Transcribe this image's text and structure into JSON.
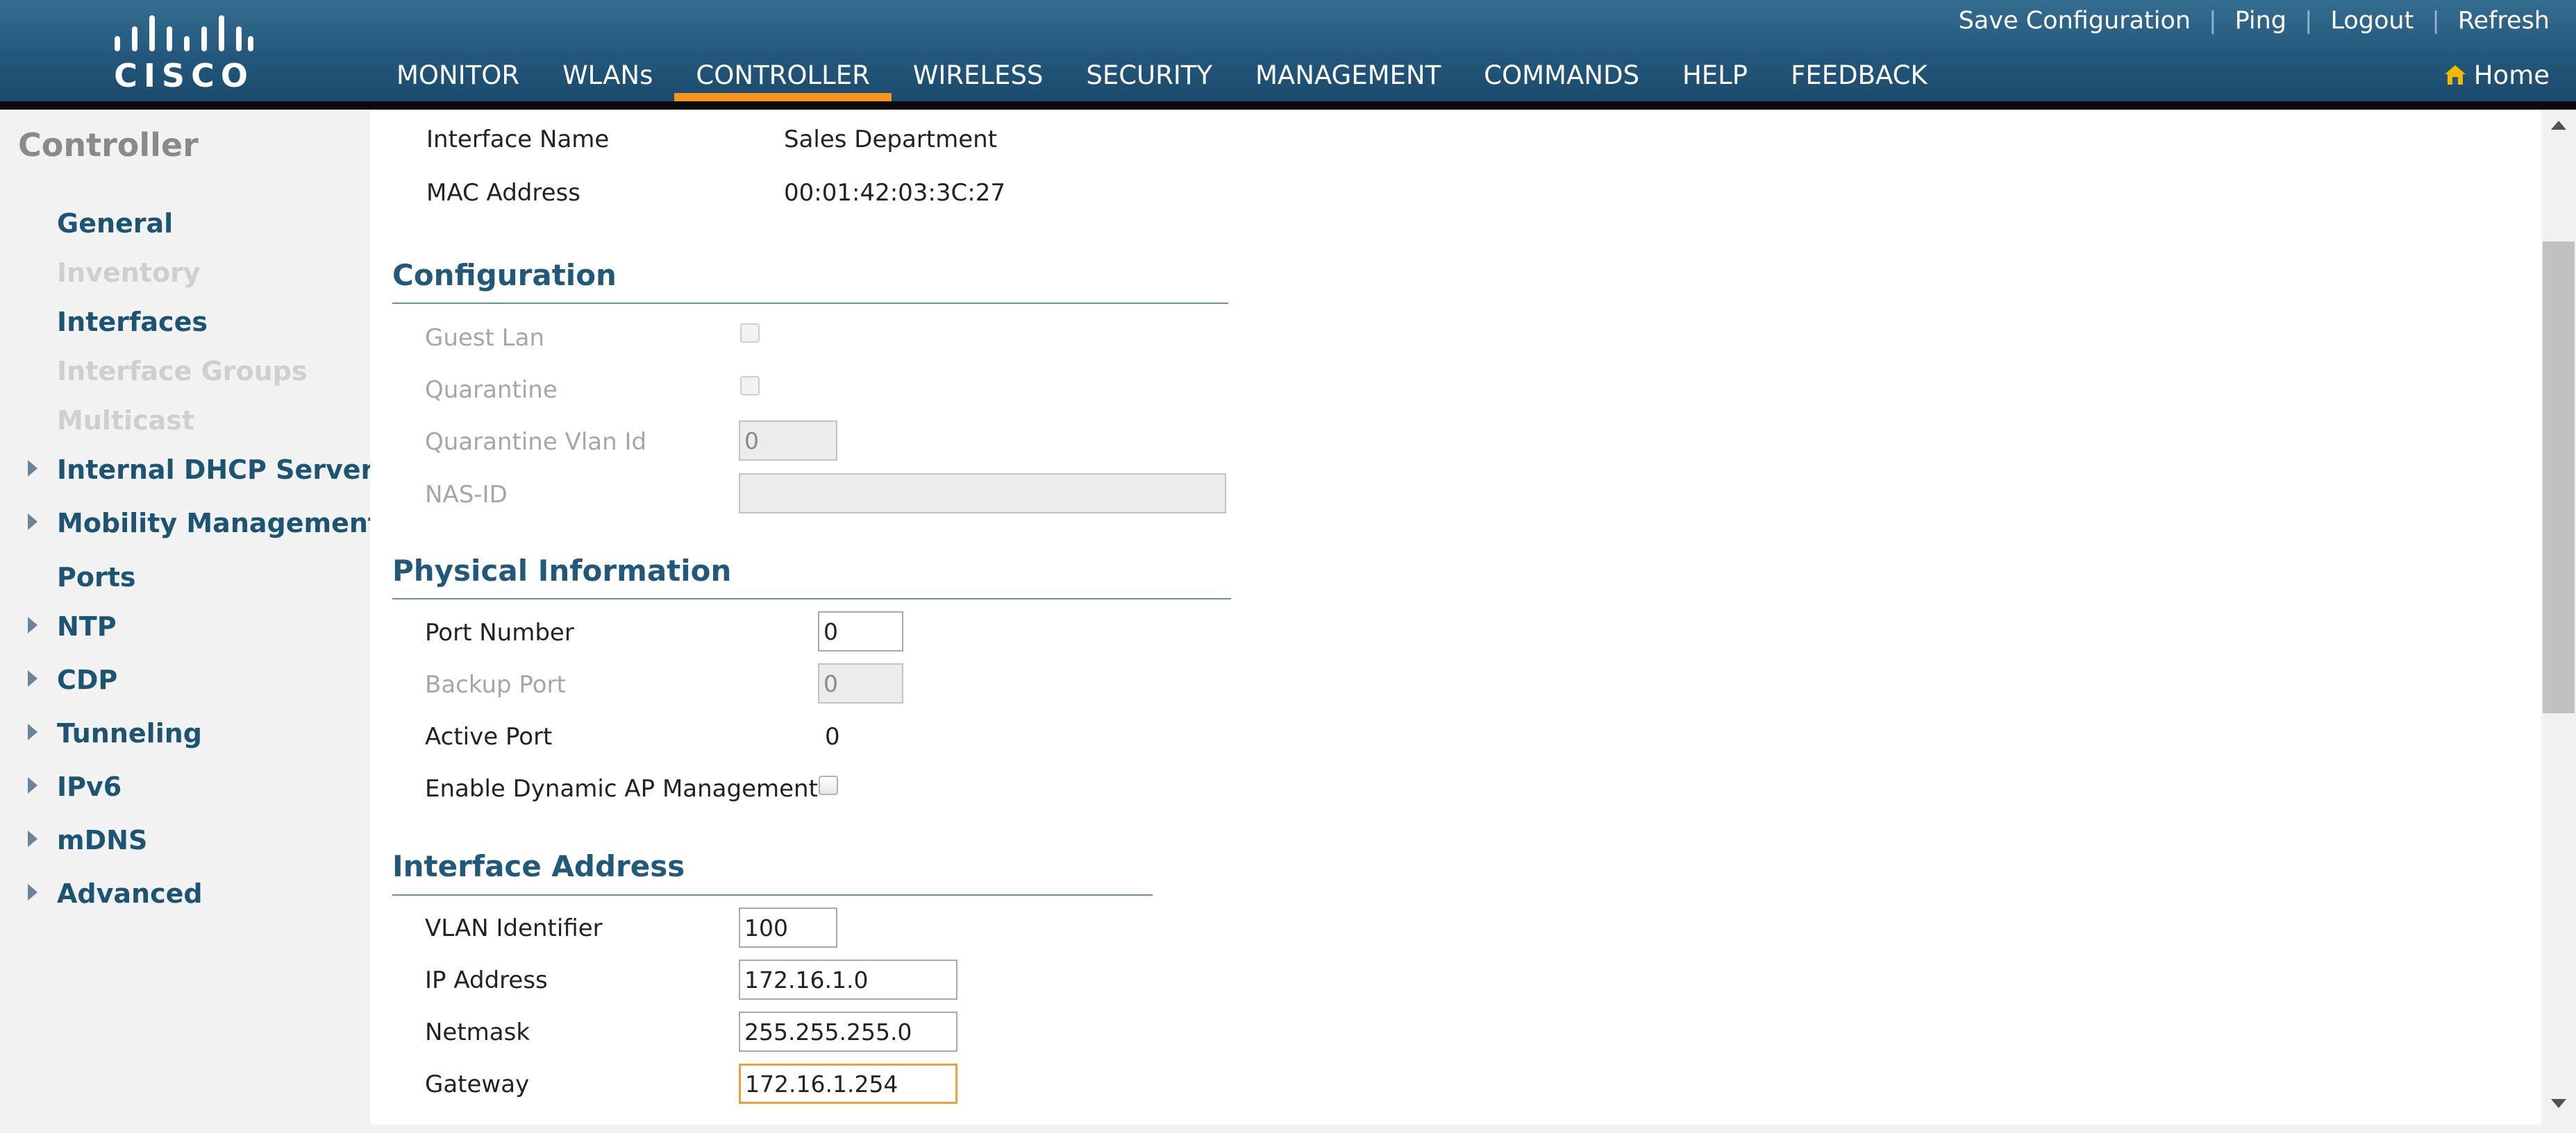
{
  "header": {
    "logo_text": "CISCO",
    "top_links": {
      "save_configuration": "Save Configuration",
      "ping": "Ping",
      "logout": "Logout",
      "refresh": "Refresh",
      "separator": "|"
    },
    "nav": [
      "MONITOR",
      "WLANs",
      "CONTROLLER",
      "WIRELESS",
      "SECURITY",
      "MANAGEMENT",
      "COMMANDS",
      "HELP",
      "FEEDBACK"
    ],
    "active_nav": "CONTROLLER",
    "home_label": "Home"
  },
  "sidebar": {
    "title": "Controller",
    "items": [
      {
        "label": "General",
        "enabled": true,
        "expandable": false
      },
      {
        "label": "Inventory",
        "enabled": false,
        "expandable": false
      },
      {
        "label": "Interfaces",
        "enabled": true,
        "expandable": false
      },
      {
        "label": "Interface Groups",
        "enabled": false,
        "expandable": false
      },
      {
        "label": "Multicast",
        "enabled": false,
        "expandable": false
      },
      {
        "label": "Internal DHCP Server",
        "enabled": true,
        "expandable": true
      },
      {
        "label": "Mobility Management",
        "enabled": true,
        "expandable": true
      },
      {
        "label": "Ports",
        "enabled": true,
        "expandable": false
      },
      {
        "label": "NTP",
        "enabled": true,
        "expandable": true
      },
      {
        "label": "CDP",
        "enabled": true,
        "expandable": true
      },
      {
        "label": "Tunneling",
        "enabled": true,
        "expandable": true
      },
      {
        "label": "IPv6",
        "enabled": true,
        "expandable": true
      },
      {
        "label": "mDNS",
        "enabled": true,
        "expandable": true
      },
      {
        "label": "Advanced",
        "enabled": true,
        "expandable": true
      }
    ]
  },
  "general": {
    "interface_name_label": "Interface Name",
    "interface_name_value": "Sales Department",
    "mac_address_label": "MAC Address",
    "mac_address_value": "00:01:42:03:3C:27"
  },
  "configuration": {
    "title": "Configuration",
    "guest_lan_label": "Guest Lan",
    "guest_lan_checked": false,
    "quarantine_label": "Quarantine",
    "quarantine_checked": false,
    "quarantine_vlan_id_label": "Quarantine Vlan Id",
    "quarantine_vlan_id_value": "0",
    "nas_id_label": "NAS-ID",
    "nas_id_value": ""
  },
  "physical": {
    "title": "Physical Information",
    "port_number_label": "Port Number",
    "port_number_value": "0",
    "backup_port_label": "Backup Port",
    "backup_port_value": "0",
    "active_port_label": "Active Port",
    "active_port_value": "0",
    "dynamic_ap_label": "Enable Dynamic AP Management",
    "dynamic_ap_checked": false
  },
  "interface_address": {
    "title": "Interface Address",
    "vlan_identifier_label": "VLAN Identifier",
    "vlan_identifier_value": "100",
    "ip_address_label": "IP Address",
    "ip_address_value": "172.16.1.0",
    "netmask_label": "Netmask",
    "netmask_value": "255.255.255.0",
    "gateway_label": "Gateway",
    "gateway_value": "172.16.1.254"
  },
  "colors": {
    "header_blue": "#23587c",
    "active_tab_accent": "#f7941d",
    "section_title": "#22597a",
    "sidebar_link": "#1d5472",
    "focus_border": "#e8a33d",
    "home_icon": "#f5b800"
  }
}
